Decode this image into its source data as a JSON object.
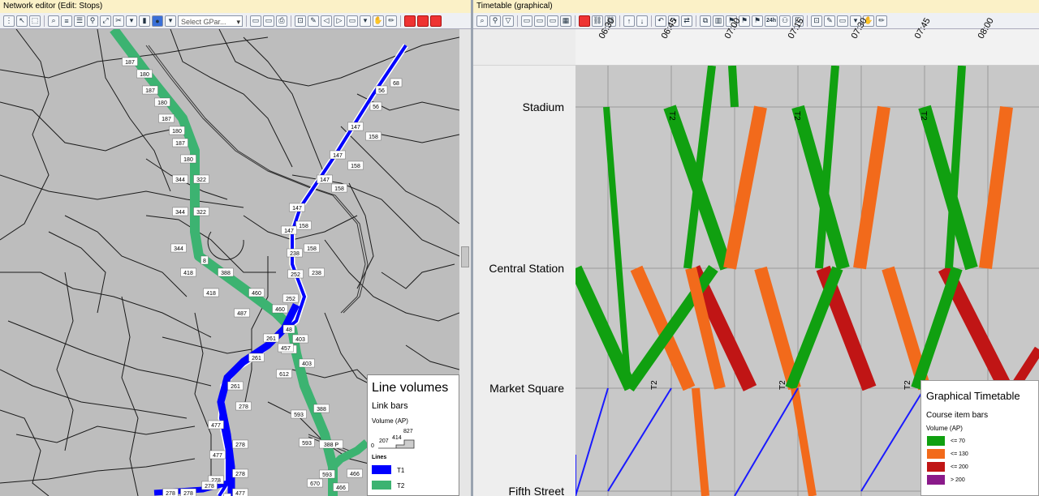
{
  "left_window": {
    "title": "Network editor (Edit: Stops)",
    "select_placeholder": "Select GPar...",
    "legend": {
      "title": "Line volumes",
      "subtitle": "Link bars",
      "volume_label": "Volume (AP)",
      "scale_values": [
        "0",
        "207",
        "414",
        "827"
      ],
      "lines_label": "Lines",
      "lines": [
        {
          "name": "T1",
          "color": "#0000ff"
        },
        {
          "name": "T2",
          "color": "#3cb371"
        }
      ]
    },
    "link_labels": {
      "t2_north": [
        "187",
        "180",
        "187",
        "180",
        "187",
        "180",
        "187",
        "180"
      ],
      "t2_mid": [
        "344",
        "322",
        "344",
        "322",
        "344",
        "8",
        "418",
        "388",
        "418",
        "460",
        "487",
        "460"
      ],
      "t2_south": [
        "457",
        "612",
        "403",
        "593",
        "388",
        "593",
        "388 P",
        "593",
        "466",
        "466",
        "670"
      ],
      "t1_north": [
        "56",
        "68",
        "56",
        "147",
        "158",
        "147",
        "158",
        "147",
        "158",
        "147",
        "158",
        "147",
        "158",
        "238",
        "252",
        "238",
        "252"
      ],
      "t1_south": [
        "48",
        "261",
        "403",
        "261",
        "457",
        "261",
        "278",
        "477",
        "278",
        "477",
        "278",
        "278",
        "278",
        "278",
        "278",
        "477",
        "8"
      ]
    }
  },
  "right_window": {
    "title": "Timetable (graphical)",
    "toolbar_24h": "24h",
    "times": [
      "06:30",
      "06:45",
      "07:00",
      "07:15",
      "07:30",
      "07:45",
      "08:00"
    ],
    "stations": [
      "Stadium",
      "Central Station",
      "Market Square",
      "Fifth Street"
    ],
    "line_labels": [
      "T2",
      "T2",
      "T2",
      "T2",
      "T2",
      "T2"
    ],
    "legend": {
      "title": "Graphical Timetable",
      "subtitle": "Course item bars",
      "volume_label": "Volume (AP)",
      "classes": [
        {
          "label": "<= 70",
          "color": "#10a010"
        },
        {
          "label": "<= 130",
          "color": "#f26a1b"
        },
        {
          "label": "<= 200",
          "color": "#c01515"
        },
        {
          "label": "> 200",
          "color": "#8a1a8a"
        }
      ]
    }
  }
}
